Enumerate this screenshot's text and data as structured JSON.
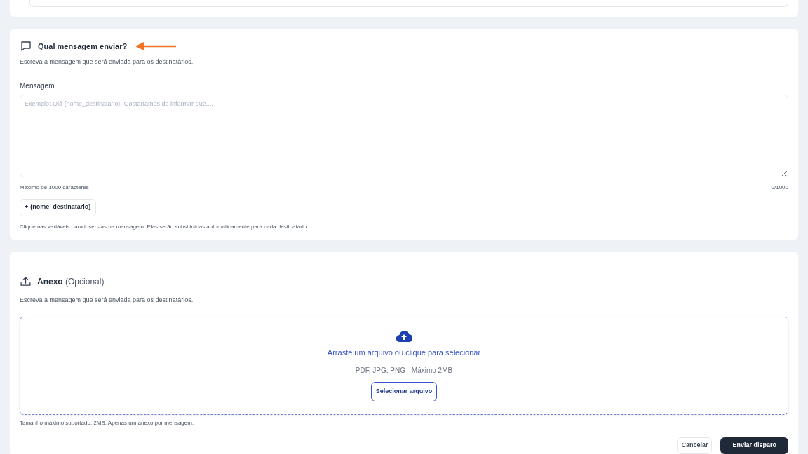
{
  "message_section": {
    "title": "Qual mensagem enviar?",
    "description": "Escreva a mensagem que será enviada para os destinatários.",
    "field_label": "Mensagem",
    "placeholder": "Exemplo: Olá {nome_destinatario}! Gostaríamos de informar que....",
    "limit_note": "Máximo de 1000 caracteres",
    "counter": "0/1000",
    "variables": [
      "+ {nome_destinatario}"
    ],
    "variables_hint": "Clique nas variáveis para inseri-las na mensagem. Elas serão substituídas automaticamente para cada destinatário."
  },
  "attachment_section": {
    "title": "Anexo",
    "title_suffix": "(Opcional)",
    "description": "Escreva a mensagem que será enviada para os destinatários.",
    "drop_text": "Arraste um arquivo ou clique para selecionar",
    "formats": "PDF, JPG, PNG - Máximo 2MB",
    "select_button": "Selecionar arquivo",
    "size_note": "Tamanho máximo suportado: 2MB. Apenas um anexo por mensagem."
  },
  "actions": [
    {
      "label": "Cancelar",
      "kind": "secondary"
    },
    {
      "label": "Enviar disparo",
      "kind": "primary"
    }
  ]
}
